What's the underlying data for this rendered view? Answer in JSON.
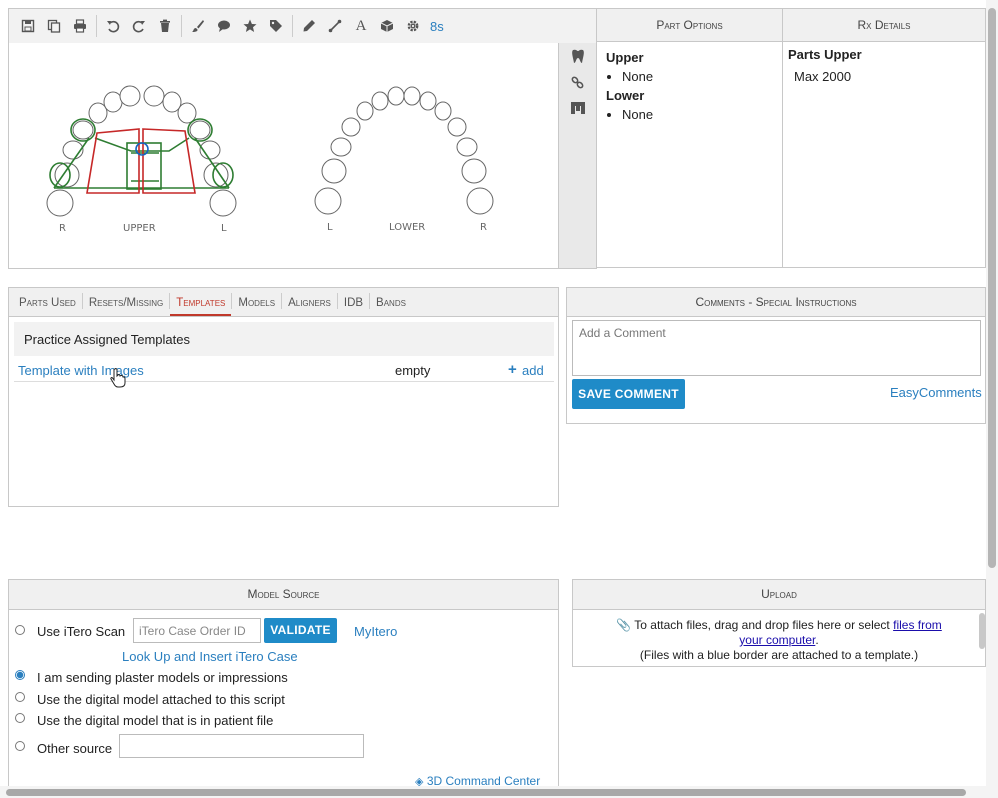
{
  "toolbar": {
    "timer": "8s"
  },
  "chart": {
    "upper_label": "UPPER",
    "lower_label": "LOWER",
    "upper_r": "R",
    "upper_l": "L",
    "lower_l": "L",
    "lower_r": "R"
  },
  "part_options": {
    "title": "Part Options",
    "upper_heading": "Upper",
    "upper_item": "None",
    "lower_heading": "Lower",
    "lower_item": "None"
  },
  "rx_details": {
    "title": "Rx Details",
    "parts_upper_heading": "Parts Upper",
    "parts_upper_value": "Max 2000"
  },
  "tabs": [
    {
      "label": "Parts Used"
    },
    {
      "label": "Resets/Missing"
    },
    {
      "label": "Templates"
    },
    {
      "label": "Models"
    },
    {
      "label": "Aligners"
    },
    {
      "label": "IDB"
    },
    {
      "label": "Bands"
    }
  ],
  "templates": {
    "section_title": "Practice Assigned Templates",
    "row_name": "Template with Images",
    "row_status": "empty",
    "row_action": "add"
  },
  "comments": {
    "title": "Comments - Special Instructions",
    "placeholder": "Add a Comment",
    "save_label": "SAVE COMMENT",
    "easy_link": "EasyComments"
  },
  "model_source": {
    "title": "Model Source",
    "itero_label": "Use iTero Scan",
    "itero_placeholder": "iTero Case Order ID",
    "validate_label": "VALIDATE",
    "myitero_link": "MyItero",
    "lookup_link": "Look Up and Insert iTero Case",
    "opt_plaster": "I am sending plaster models or impressions",
    "opt_digital_script": "Use the digital model attached to this script",
    "opt_digital_patient": "Use the digital model that is in patient file",
    "opt_other": "Other source",
    "command_center": "3D Command Center"
  },
  "upload": {
    "title": "Upload",
    "line1": "To attach files, drag and drop files here or select",
    "link": "files from your computer",
    "link_a": "files from",
    "link_b": "your computer",
    "line3": "(Files with a blue border are attached to a template.)"
  }
}
